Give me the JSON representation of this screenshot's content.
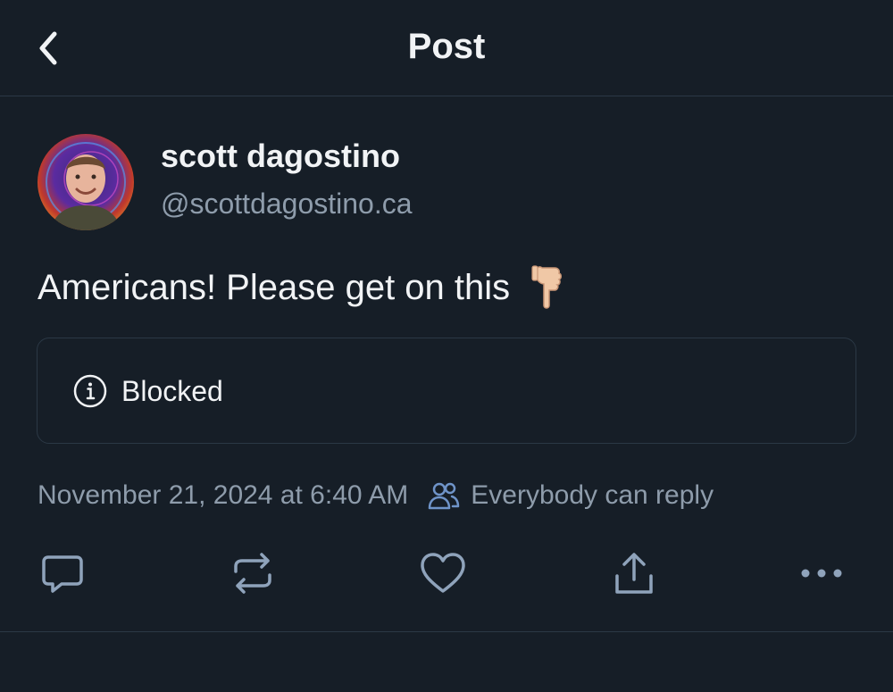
{
  "header": {
    "title": "Post",
    "back_icon": "chevron-left-icon"
  },
  "author": {
    "display_name": "scott dagostino",
    "handle": "@scottdagostino.ca"
  },
  "post": {
    "text": "Americans! Please get on this",
    "emoji": "pointing-down-hand-emoji"
  },
  "embed": {
    "status_label": "Blocked",
    "icon": "info-circle-icon"
  },
  "meta": {
    "timestamp": "November 21, 2024 at 6:40 AM",
    "reply_setting": "Everybody can reply",
    "reply_icon": "people-icon"
  },
  "actions": [
    "reply-icon",
    "repost-icon",
    "like-icon",
    "share-icon",
    "more-icon"
  ],
  "colors": {
    "background": "#161e27",
    "text": "#f1f3f5",
    "muted": "#8e9cab",
    "border": "#2b3845",
    "icon": "#8fa3bb"
  }
}
